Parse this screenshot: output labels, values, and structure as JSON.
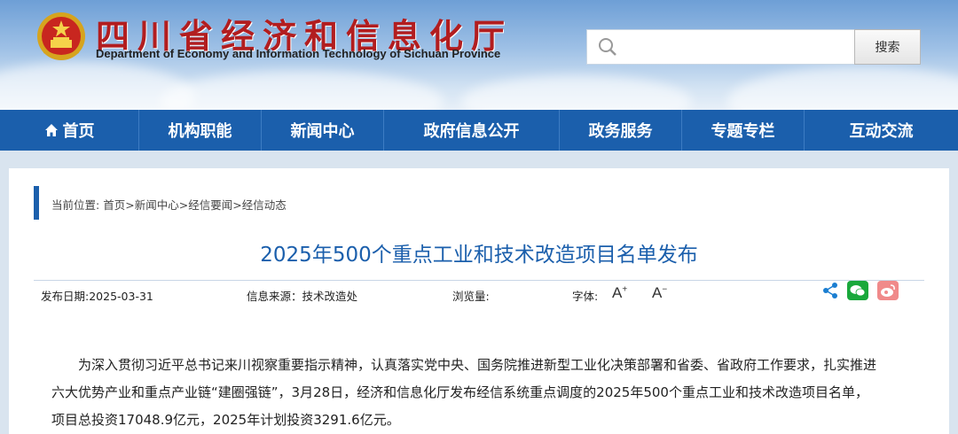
{
  "header": {
    "title_cn": "四川省经济和信息化厅",
    "title_en": "Department of Economy and Information Technology of Sichuan Province"
  },
  "search": {
    "placeholder": "",
    "button_label": "搜索"
  },
  "nav": {
    "items": [
      {
        "label": "首页",
        "icon": "home-icon"
      },
      {
        "label": "机构职能"
      },
      {
        "label": "新闻中心"
      },
      {
        "label": "政府信息公开"
      },
      {
        "label": "政务服务"
      },
      {
        "label": "专题专栏"
      },
      {
        "label": "互动交流"
      }
    ]
  },
  "breadcrumb": {
    "prefix": "当前位置:",
    "items": [
      "首页",
      "新闻中心",
      "经信要闻",
      "经信动态"
    ]
  },
  "article": {
    "title": "2025年500个重点工业和技术改造项目名单发布",
    "date_label": "发布日期:2025-03-31",
    "source_label": "信息来源：",
    "source_value": "技术改造处",
    "views_label": "浏览量:",
    "font_label": "字体:",
    "font_increase": "A",
    "font_decrease": "A",
    "lines": [
      "为深入贯彻习近平总书记来川视察重要指示精神，认真落实党中央、国务院推进新型工业化决策部署和省委、省政府工作要求，扎实推进",
      "六大优势产业和重点产业链“建圈强链”，3月28日，经济和信息化厅发布经信系统重点调度的2025年500个重点工业和技术改造项目名单，",
      "项目总投资17048.9亿元，2025年计划投资3291.6亿元。"
    ]
  },
  "colors": {
    "nav_bg": "#1b5fac",
    "title_red": "#b21d1f",
    "article_title": "#1b5fac",
    "wechat": "#19a83b",
    "weibo": "#f08a8a"
  }
}
